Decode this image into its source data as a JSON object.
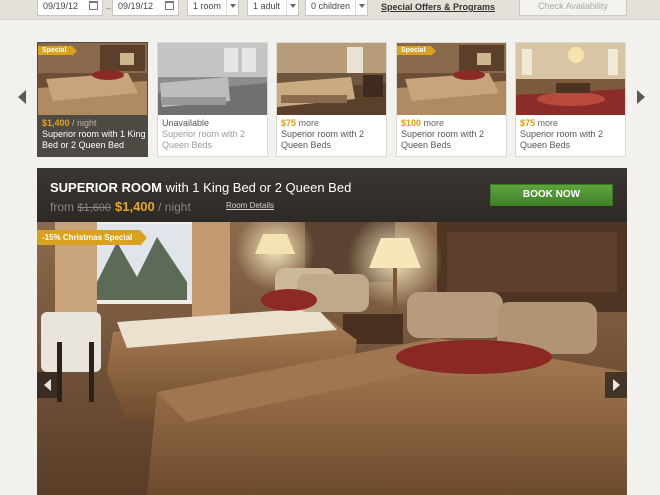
{
  "search": {
    "checkin": "09/19/12",
    "checkout": "09/19/12",
    "rooms": "1 room",
    "adults": "1 adult",
    "children": "0 children",
    "offers_link": "Special Offers & Programs",
    "check_button": "Check Availability"
  },
  "rooms_strip": [
    {
      "tag": "Special",
      "price": "$1,400",
      "per_night": " / night",
      "description": "Superior room with 1 King Bed or 2 Queen Bed",
      "state": "selected"
    },
    {
      "status": "Unavailable",
      "description": "Superior room with 2 Queen Beds",
      "state": "unavailable"
    },
    {
      "price_diff": "$75",
      "more_label": " more",
      "description": "Superior room with 2 Queen Beds"
    },
    {
      "tag": "Special",
      "price_diff": "$100",
      "more_label": " more",
      "description": "Superior room with 2 Queen Beds"
    },
    {
      "price_diff": "$75",
      "more_label": " more",
      "description": "Superior room with 2 Queen Beds"
    }
  ],
  "detail": {
    "title_bold": "SUPERIOR ROOM",
    "title_rest": " with 1 King Bed or 2 Queen Bed",
    "from_label": "from ",
    "old_price": "$1,600",
    "price": "$1,400",
    "per_night": " / night",
    "details_link": "Room Details",
    "book_button": "BOOK NOW",
    "promo_tag": "-15% Christmas Special"
  },
  "colors": {
    "accent_gold": "#d9a21e",
    "book_green": "#4f9434",
    "header_dark": "#332e29"
  }
}
